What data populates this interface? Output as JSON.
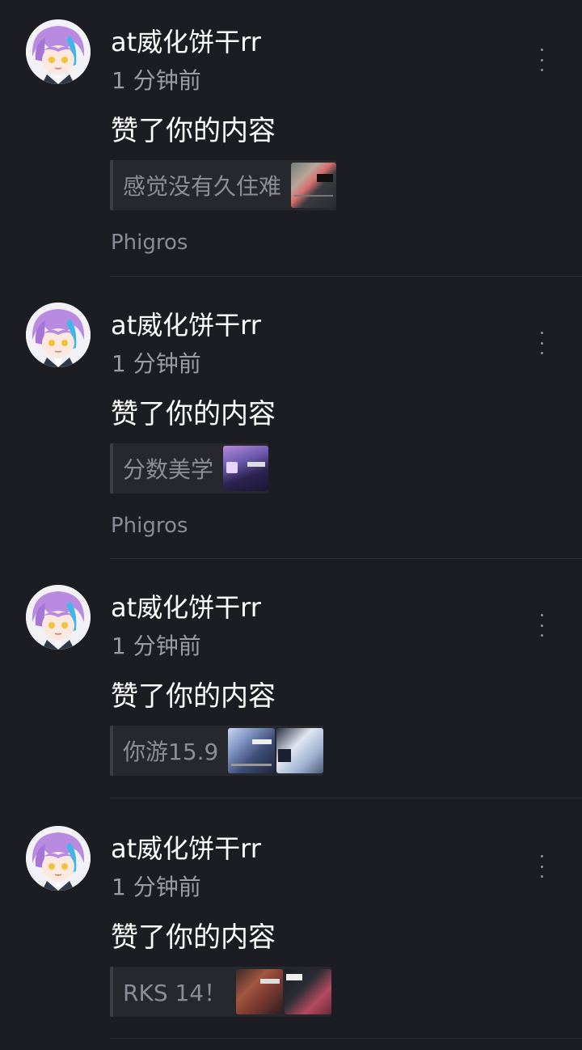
{
  "notifications": [
    {
      "username": "at威化饼干rr",
      "time": "1 分钟前",
      "action": "赞了你的内容",
      "preview_text": "感觉没有久住难",
      "thumbnails": [
        "thumb-a"
      ],
      "source": "Phigros"
    },
    {
      "username": "at威化饼干rr",
      "time": "1 分钟前",
      "action": "赞了你的内容",
      "preview_text": "分数美学",
      "thumbnails": [
        "thumb-b"
      ],
      "source": "Phigros"
    },
    {
      "username": "at威化饼干rr",
      "time": "1 分钟前",
      "action": "赞了你的内容",
      "preview_text": "你游15.9",
      "thumbnails": [
        "thumb-c",
        "thumb-d"
      ]
    },
    {
      "username": "at威化饼干rr",
      "time": "1 分钟前",
      "action": "赞了你的内容",
      "preview_text": "RKS 14！",
      "thumbnails": [
        "thumb-e",
        "thumb-f"
      ]
    }
  ],
  "colors": {
    "background": "#1c1d23",
    "avatar_hair": "#b98be0",
    "avatar_streak": "#3fb6e8"
  }
}
